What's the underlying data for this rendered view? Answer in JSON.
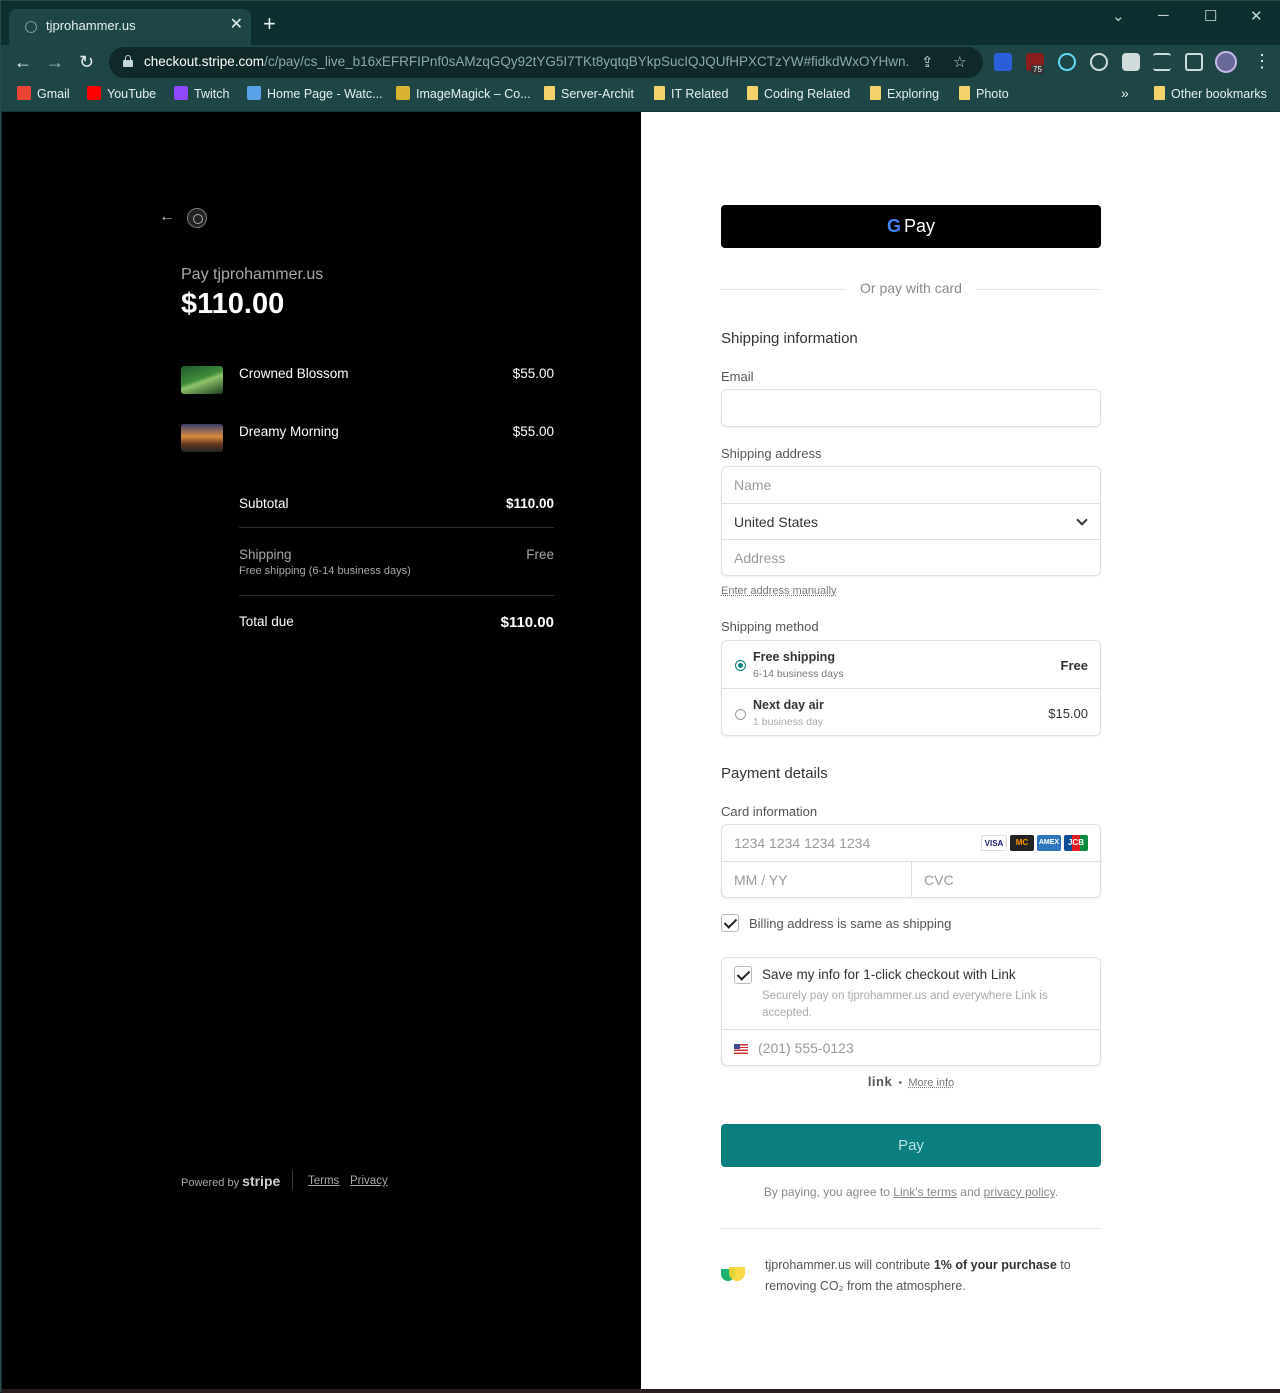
{
  "browser": {
    "tab_title": "tjprohammer.us",
    "tab_close": "✕",
    "new_tab": "+",
    "window_controls": {
      "minimize": "─",
      "maximize": "☐",
      "close": "✕",
      "dropdown": "⌄"
    },
    "nav": {
      "back": "←",
      "forward": "→",
      "reload": "↻"
    },
    "url_host": "checkout.stripe.com",
    "url_path": "/c/pay/cs_live_b16xEFRFIPnf0sAMzqGQy92tYG5I7TKt8yqtqBYkpSucIQJQUfHPXCTzYW#fidkdWxOYHwn...",
    "extension_badge": "75",
    "bookmarks": [
      {
        "label": "Gmail",
        "icon": "gmail-icon",
        "color": "#ea4335"
      },
      {
        "label": "YouTube",
        "icon": "youtube-icon",
        "color": "#ff0000"
      },
      {
        "label": "Twitch",
        "icon": "twitch-icon",
        "color": "#9146ff"
      },
      {
        "label": "Home Page - Watc...",
        "icon": "pencil-icon",
        "color": "#5aa2e8"
      },
      {
        "label": "ImageMagick – Co...",
        "icon": "wand-icon",
        "color": "#d9b331"
      },
      {
        "label": "Server-Archit",
        "icon": "folder-icon"
      },
      {
        "label": "IT Related",
        "icon": "folder-icon"
      },
      {
        "label": "Coding Related",
        "icon": "folder-icon"
      },
      {
        "label": "Exploring",
        "icon": "folder-icon"
      },
      {
        "label": "Photo",
        "icon": "folder-icon"
      }
    ],
    "bookmarks_more": "»",
    "other_bookmarks": "Other bookmarks"
  },
  "summary": {
    "pay_to": "Pay tjprohammer.us",
    "amount": "$110.00",
    "items": [
      {
        "name": "Crowned Blossom",
        "price": "$55.00"
      },
      {
        "name": "Dreamy Morning",
        "price": "$55.00"
      }
    ],
    "subtotal_label": "Subtotal",
    "subtotal_value": "$110.00",
    "shipping_label": "Shipping",
    "shipping_sub": "Free shipping (6-14 business days)",
    "shipping_value": "Free",
    "total_label": "Total due",
    "total_value": "$110.00",
    "powered_by": "Powered by",
    "stripe": "stripe",
    "terms": "Terms",
    "privacy": "Privacy"
  },
  "checkout": {
    "gpay_label": "Pay",
    "gpay_g": "G",
    "or_pay": "Or pay with card",
    "shipping_info_title": "Shipping information",
    "email_label": "Email",
    "email_value": "",
    "shipping_address_label": "Shipping address",
    "name_placeholder": "Name",
    "country_value": "United States",
    "address_placeholder": "Address",
    "enter_manually": "Enter address manually",
    "shipping_method_label": "Shipping method",
    "methods": [
      {
        "name": "Free shipping",
        "sub": "6-14 business days",
        "price": "Free",
        "selected": true
      },
      {
        "name": "Next day air",
        "sub": "1 business day",
        "price": "$15.00",
        "selected": false
      }
    ],
    "payment_details_title": "Payment details",
    "card_info_label": "Card information",
    "card_number_placeholder": "1234 1234 1234 1234",
    "expiry_placeholder": "MM / YY",
    "cvc_placeholder": "CVC",
    "card_brands": [
      "VISA",
      "MC",
      "AMEX",
      "JCB"
    ],
    "billing_same": "Billing address is same as shipping",
    "save_info_title": "Save my info for 1-click checkout with Link",
    "save_info_sub": "Securely pay on tjprohammer.us and everywhere Link is accepted.",
    "phone_placeholder": "(201) 555-0123",
    "link_brand": "link",
    "link_dot": "•",
    "more_info": "More info",
    "pay_button": "Pay",
    "terms_prefix": "By paying, you agree to",
    "links_terms": "Link's terms",
    "terms_and": "and",
    "privacy_policy": "privacy policy",
    "terms_suffix": ".",
    "climate_pre": "tjprohammer.us will contribute",
    "climate_bold": "1% of your purchase",
    "climate_post": "to removing CO₂ from the atmosphere."
  },
  "colors": {
    "accent": "#0b7f7f",
    "browser_chrome": "#1f4646",
    "summary_bg": "#000000"
  }
}
